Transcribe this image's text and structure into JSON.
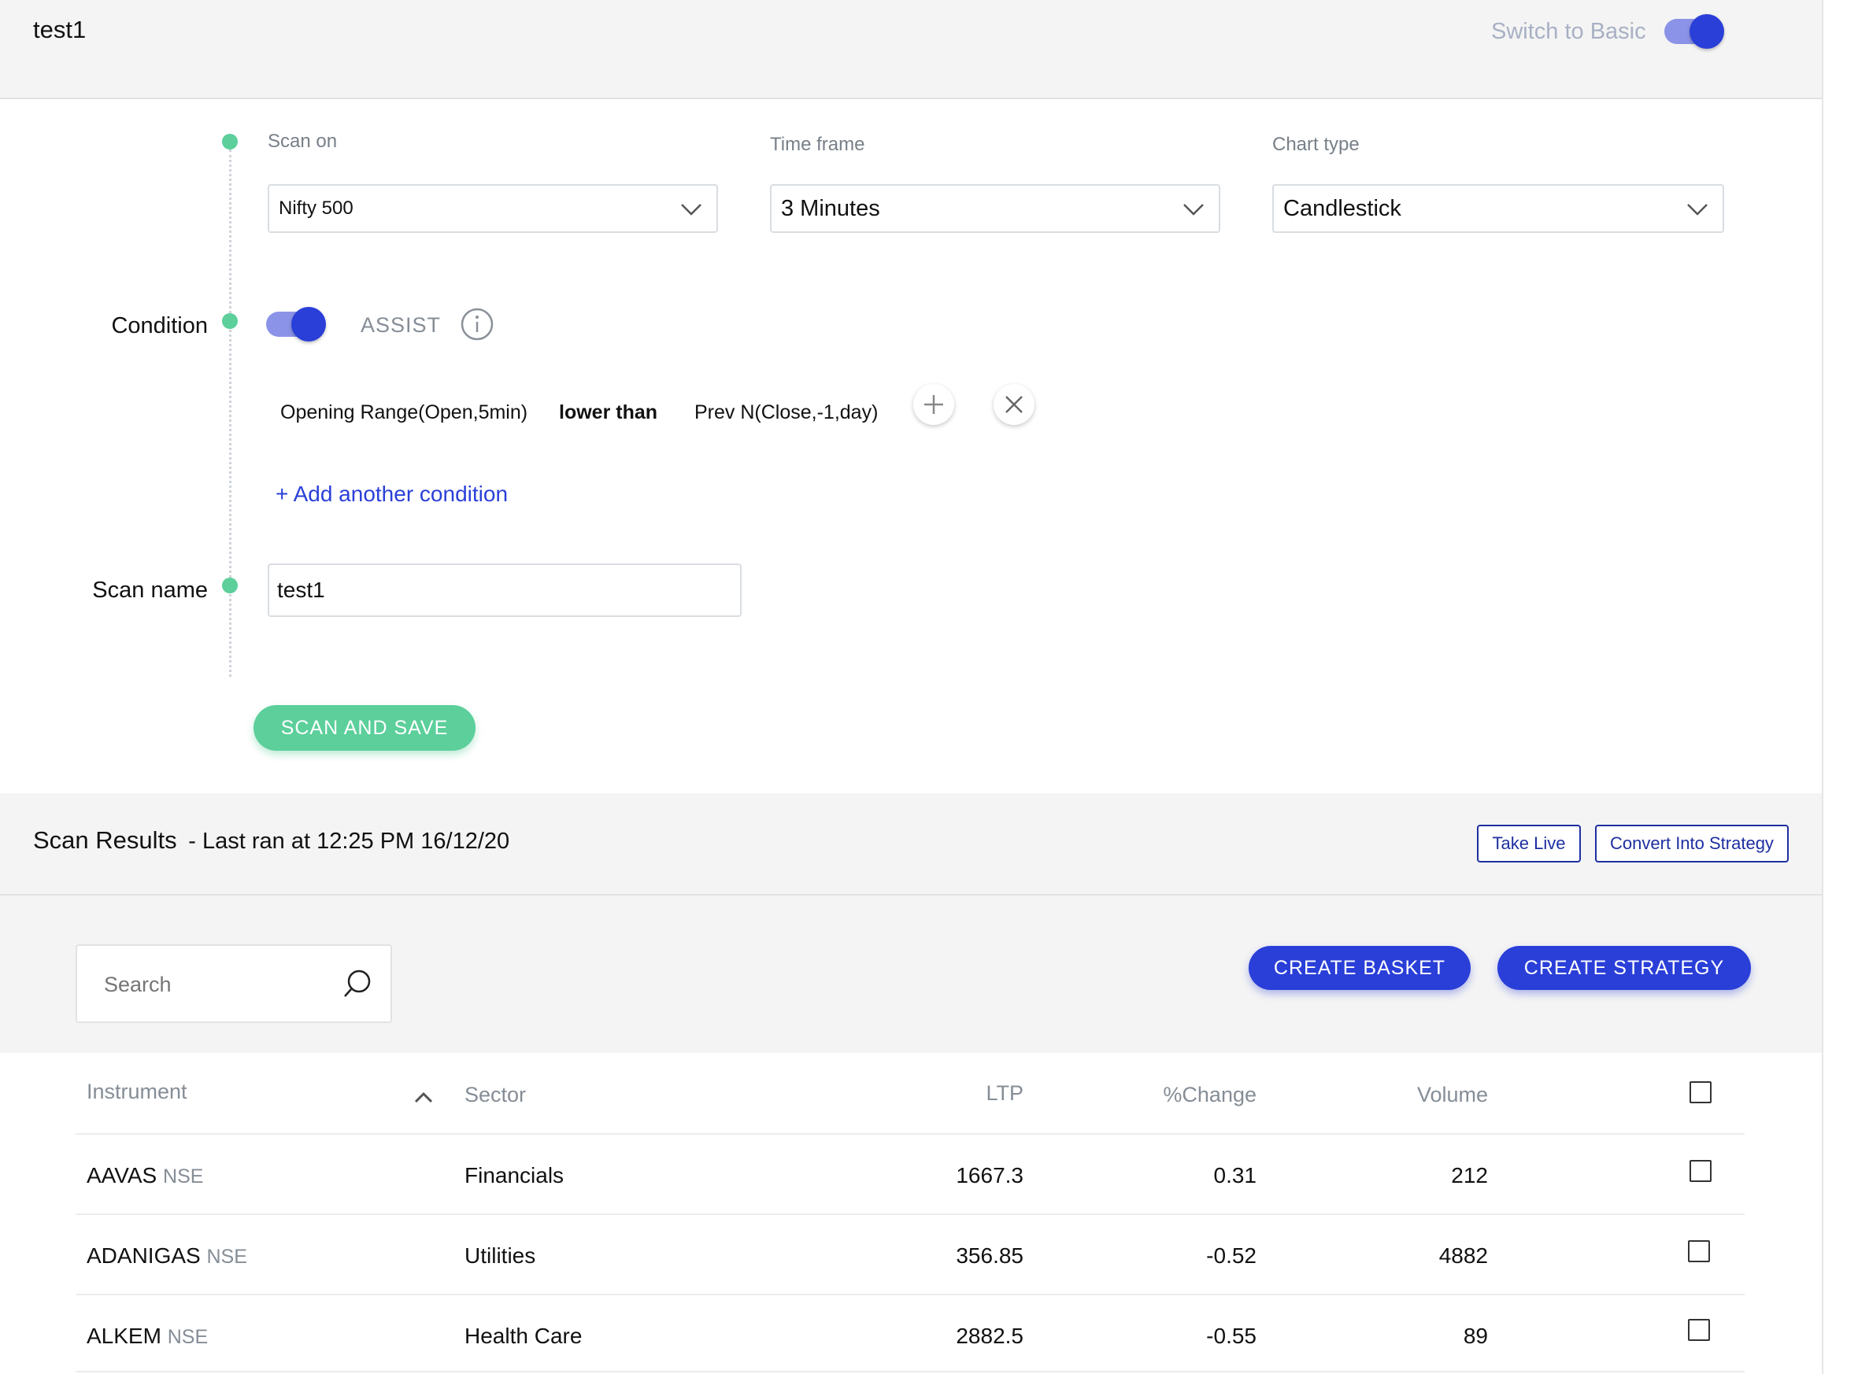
{
  "header": {
    "title": "test1",
    "switch_label": "Switch to Basic"
  },
  "scan_config": {
    "scan_on": {
      "label": "Scan on",
      "value": "Nifty 500"
    },
    "time_frame": {
      "label": "Time frame",
      "value": "3 Minutes"
    },
    "chart_type": {
      "label": "Chart type",
      "value": "Candlestick"
    }
  },
  "condition": {
    "label": "Condition",
    "assist_label": "ASSIST",
    "left_operand": "Opening Range(Open,5min)",
    "operator": "lower than",
    "right_operand": "Prev N(Close,-1,day)",
    "add_condition": "+ Add another condition"
  },
  "scan_name": {
    "label": "Scan name",
    "value": "test1"
  },
  "scan_and_save": "SCAN AND SAVE",
  "results": {
    "title": "Scan Results",
    "last_ran": "- Last ran at 12:25 PM 16/12/20",
    "take_live": "Take Live",
    "convert": "Convert Into Strategy",
    "search_placeholder": "Search",
    "create_basket": "CREATE BASKET",
    "create_strategy": "CREATE STRATEGY",
    "columns": {
      "instrument": "Instrument",
      "sector": "Sector",
      "ltp": "LTP",
      "change": "%Change",
      "volume": "Volume"
    },
    "rows": [
      {
        "symbol": "AAVAS",
        "exchange": "NSE",
        "sector": "Financials",
        "ltp": "1667.3",
        "change": "0.31",
        "volume": "212"
      },
      {
        "symbol": "ADANIGAS",
        "exchange": "NSE",
        "sector": "Utilities",
        "ltp": "356.85",
        "change": "-0.52",
        "volume": "4882"
      },
      {
        "symbol": "ALKEM",
        "exchange": "NSE",
        "sector": "Health Care",
        "ltp": "2882.5",
        "change": "-0.55",
        "volume": "89"
      }
    ]
  },
  "colors": {
    "accent_blue": "#2a3fd8",
    "green": "#5ccf9b",
    "outline_blue": "#1d2fa0"
  },
  "icons": {
    "info": "info-circle-icon",
    "plus": "plus-icon",
    "close": "close-icon",
    "search": "search-icon",
    "sort": "chevron-up-icon"
  }
}
